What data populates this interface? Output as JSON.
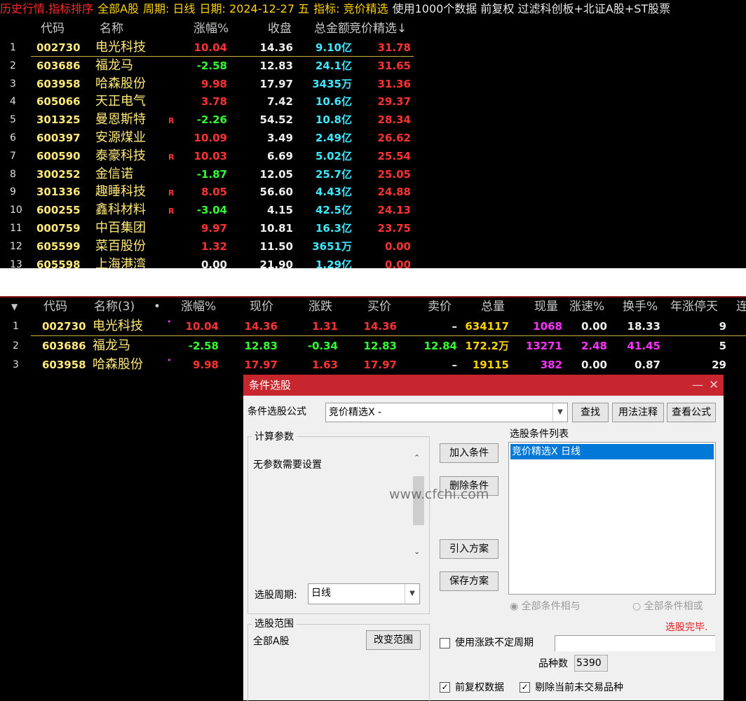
{
  "topbar": {
    "t1": "历史行情.指标排序",
    "t2": "全部A股",
    "t3": "周期: 日线",
    "t4": "日期: 2024-12-27 五",
    "t5": "指标: 竞价精选",
    "t6": "使用1000个数据 前复权 过滤科创板+北证A股+ST股票"
  },
  "top_headers": {
    "code": "代码",
    "name": "名称",
    "pct": "涨幅%",
    "close": "收盘",
    "amount": "总金额",
    "jj": "竞价精选↓"
  },
  "top_rows": [
    {
      "idx": "1",
      "code": "002730",
      "name": "电光科技",
      "r": "",
      "pct": "10.04",
      "close": "14.36",
      "amount": "9.10亿",
      "jj": "31.78"
    },
    {
      "idx": "2",
      "code": "603686",
      "name": "福龙马",
      "r": "",
      "pct": "-2.58",
      "close": "12.83",
      "amount": "24.1亿",
      "jj": "31.65"
    },
    {
      "idx": "3",
      "code": "603958",
      "name": "哈森股份",
      "r": "",
      "pct": "9.98",
      "close": "17.97",
      "amount": "3435万",
      "jj": "31.36"
    },
    {
      "idx": "4",
      "code": "605066",
      "name": "天正电气",
      "r": "",
      "pct": "3.78",
      "close": "7.42",
      "amount": "10.6亿",
      "jj": "29.37"
    },
    {
      "idx": "5",
      "code": "301325",
      "name": "曼恩斯特",
      "r": "R",
      "pct": "-2.26",
      "close": "54.52",
      "amount": "10.8亿",
      "jj": "28.34"
    },
    {
      "idx": "6",
      "code": "600397",
      "name": "安源煤业",
      "r": "",
      "pct": "10.09",
      "close": "3.49",
      "amount": "2.49亿",
      "jj": "26.62"
    },
    {
      "idx": "7",
      "code": "600590",
      "name": "泰豪科技",
      "r": "R",
      "pct": "10.03",
      "close": "6.69",
      "amount": "5.02亿",
      "jj": "25.54"
    },
    {
      "idx": "8",
      "code": "300252",
      "name": "金信诺",
      "r": "",
      "pct": "-1.87",
      "close": "12.05",
      "amount": "25.7亿",
      "jj": "25.05"
    },
    {
      "idx": "9",
      "code": "301336",
      "name": "趣睡科技",
      "r": "R",
      "pct": "8.05",
      "close": "56.60",
      "amount": "4.43亿",
      "jj": "24.88"
    },
    {
      "idx": "10",
      "code": "600255",
      "name": "鑫科材料",
      "r": "R",
      "pct": "-3.04",
      "close": "4.15",
      "amount": "42.5亿",
      "jj": "24.13"
    },
    {
      "idx": "11",
      "code": "000759",
      "name": "中百集团",
      "r": "",
      "pct": "9.97",
      "close": "10.81",
      "amount": "16.3亿",
      "jj": "23.75"
    },
    {
      "idx": "12",
      "code": "605599",
      "name": "菜百股份",
      "r": "",
      "pct": "1.32",
      "close": "11.50",
      "amount": "3651万",
      "jj": "0.00"
    },
    {
      "idx": "13",
      "code": "605598",
      "name": "上海港湾",
      "r": "",
      "pct": "0.00",
      "close": "21.90",
      "amount": "1.29亿",
      "jj": "0.00"
    }
  ],
  "bot_headers": {
    "arrow": "▼",
    "code": "代码",
    "name": "名称(3)",
    "dot": "•",
    "pct": "涨幅%",
    "price": "现价",
    "chg": "涨跌",
    "buy": "买价",
    "sell": "卖价",
    "vol": "总量",
    "cur": "现量",
    "speed": "涨速%",
    "turn": "换手%",
    "limit": "年涨停天",
    "more": "连"
  },
  "bot_rows": [
    {
      "idx": "1",
      "code": "002730",
      "name": "电光科技",
      "pct": "10.04",
      "price": "14.36",
      "chg": "1.31",
      "buy": "14.36",
      "sell": "–",
      "vol": "634117",
      "cur": "1068",
      "speed": "0.00",
      "turn": "18.33",
      "limit": "9"
    },
    {
      "idx": "2",
      "code": "603686",
      "name": "福龙马",
      "pct": "-2.58",
      "price": "12.83",
      "chg": "-0.34",
      "buy": "12.83",
      "sell": "12.84",
      "vol": "172.2万",
      "cur": "13271",
      "speed": "2.48",
      "turn": "41.45",
      "limit": "5"
    },
    {
      "idx": "3",
      "code": "603958",
      "name": "哈森股份",
      "pct": "9.98",
      "price": "17.97",
      "chg": "1.63",
      "buy": "17.97",
      "sell": "–",
      "vol": "19115",
      "cur": "382",
      "speed": "0.00",
      "turn": "0.87",
      "limit": "29"
    }
  ],
  "dialog": {
    "title": "条件选股",
    "formula_label": "条件选股公式",
    "formula_value": "竞价精选X  -",
    "btn_find": "查找",
    "btn_usage": "用法注释",
    "btn_view": "查看公式",
    "calc_group": "计算参数",
    "no_params": "无参数需要设置",
    "period_label": "选股周期:",
    "period_value": "日线",
    "btn_add": "加入条件",
    "btn_delete": "删除条件",
    "btn_import": "引入方案",
    "btn_save": "保存方案",
    "cond_list_label": "选股条件列表",
    "cond_item": "竞价精选X  日线",
    "radio_and": "全部条件相与",
    "radio_or": "全部条件相或",
    "status": "选股完毕.",
    "range_group": "选股范围",
    "range_value": "全部A股",
    "btn_range": "改变范围",
    "chk_uncertain": "使用涨跌不定周期",
    "count_label": "品种数",
    "count_value": "5390",
    "chk_fq": "前复权数据",
    "chk_exclude": "剔除当前未交易品种",
    "watermark": "www.cfchi.com"
  },
  "colors": {
    "up": "#ff3333",
    "down": "#33ff33",
    "cyan": "#40e8ff",
    "magenta": "#ff33ff",
    "title_red": "#c8262e",
    "select_blue": "#0078d7"
  }
}
